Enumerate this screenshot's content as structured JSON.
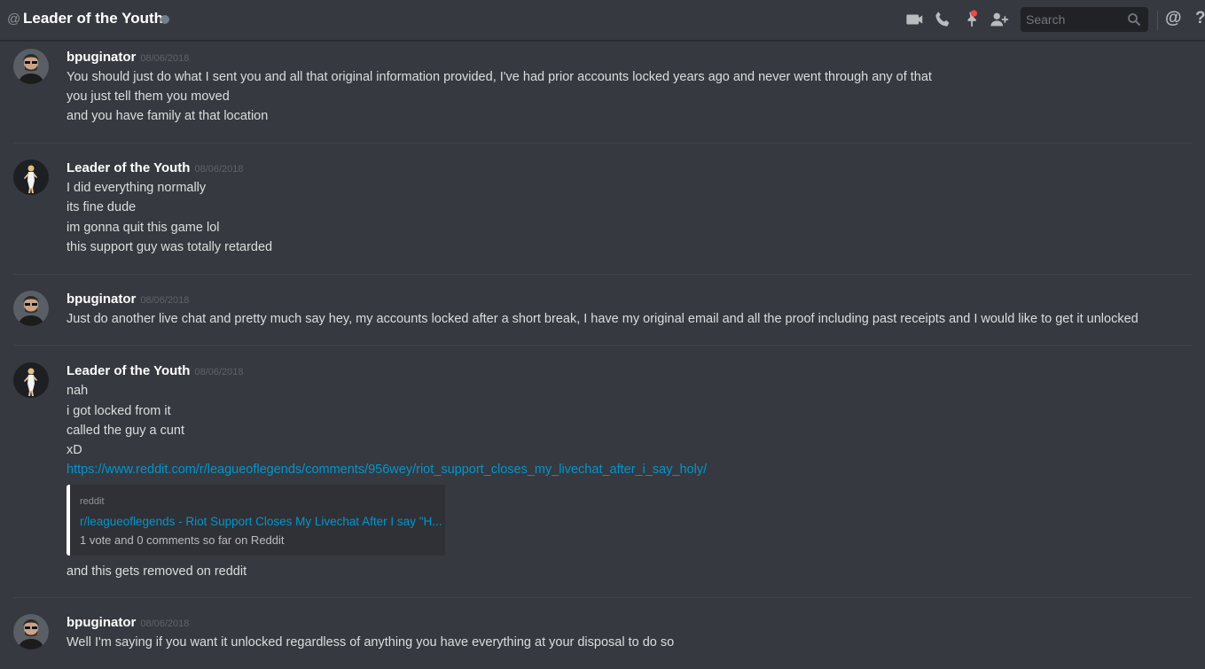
{
  "header": {
    "at_symbol": "@",
    "title": "Leader of the Youth",
    "search_placeholder": "Search",
    "icons": [
      "video-call-icon",
      "voice-call-icon",
      "pinned-icon",
      "add-friend-icon",
      "search-icon",
      "mention-icon",
      "help-icon"
    ],
    "help_glyph": "?",
    "at_glyph": "@"
  },
  "colors": {
    "background": "#36393f",
    "link": "#0096cf",
    "pin_badge": "#f04747"
  },
  "messages": [
    {
      "author": "bpuginator",
      "timestamp": "08/06/2018",
      "lines": [
        "You should just do what I sent you and all that original information provided, I've had prior accounts locked years ago and never went through any of that",
        "you just tell them you moved",
        "and you have family at that location"
      ]
    },
    {
      "author": "Leader of the Youth",
      "timestamp": "08/06/2018",
      "lines": [
        "I did everything normally",
        "its fine dude",
        "im gonna quit this game lol",
        "this support guy was totally retarded"
      ]
    },
    {
      "author": "bpuginator",
      "timestamp": "08/06/2018",
      "lines": [
        "Just do another live chat and pretty much say hey, my accounts locked after a short break, I have my original email and all the proof including past receipts and I would like to get it unlocked"
      ]
    },
    {
      "author": "Leader of the Youth",
      "timestamp": "08/06/2018",
      "lines": [
        "nah",
        "i got locked from it",
        "called the guy a cunt",
        "xD"
      ],
      "link": "https://www.reddit.com/r/leagueoflegends/comments/956wey/riot_support_closes_my_livechat_after_i_say_holy/",
      "embed": {
        "provider": "reddit",
        "title": "r/leagueoflegends - Riot Support Closes My Livechat After I say \"H...",
        "description": "1 vote and 0 comments so far on Reddit"
      },
      "after_line": "and this gets removed on reddit"
    },
    {
      "author": "bpuginator",
      "timestamp": "08/06/2018",
      "lines": [
        "Well I'm saying if you want it unlocked regardless of anything you have everything at your disposal to do so"
      ]
    }
  ]
}
